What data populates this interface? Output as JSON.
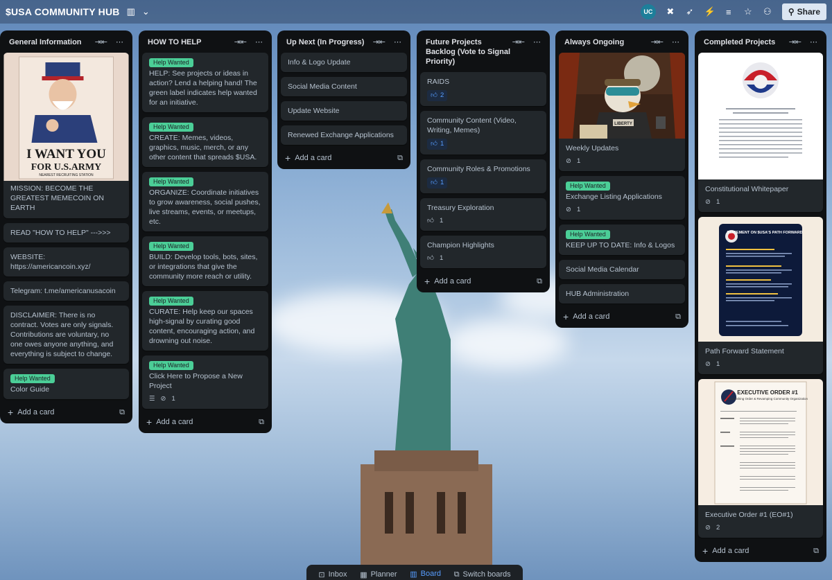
{
  "board": {
    "title": "$USA COMMUNITY HUB",
    "avatar_initials": "UC",
    "share_label": "Share"
  },
  "icons": {
    "view": "board-view-icon",
    "chevron": "chevron-down-icon",
    "collapse": "collapse-icon",
    "more": "more-icon"
  },
  "lists": [
    {
      "title": "General Information",
      "cards": [
        {
          "type": "cover",
          "cover": "uncle-sam-poster",
          "text": "MISSION: BECOME THE GREATEST MEMECOIN ON EARTH"
        },
        {
          "text": "READ \"HOW TO HELP\" --->>>"
        },
        {
          "text": "WEBSITE: https://americancoin.xyz/"
        },
        {
          "text": "Telegram: t.me/americanusacoin"
        },
        {
          "text": "DISCLAIMER: There is no contract. Votes are only signals. Contributions are voluntary, no one owes anyone anything, and everything is subject to change."
        },
        {
          "label": "Help Wanted",
          "text": "Color Guide"
        }
      ],
      "add_label": "Add a card"
    },
    {
      "title": "HOW TO HELP",
      "cards": [
        {
          "label": "Help Wanted",
          "text": "HELP: See projects or ideas in action? Lend a helping hand! The green label indicates help wanted for an initiative."
        },
        {
          "label": "Help Wanted",
          "text": "CREATE: Memes, videos, graphics, music, merch, or any other content that spreads $USA."
        },
        {
          "label": "Help Wanted",
          "text": "ORGANIZE: Coordinate initiatives to grow awareness, social pushes, live streams, events, or meetups, etc."
        },
        {
          "label": "Help Wanted",
          "text": "BUILD: Develop tools, bots, sites, or integrations that give the community more reach or utility."
        },
        {
          "label": "Help Wanted",
          "text": "CURATE: Help keep our spaces high-signal by curating good content, encouraging action, and drowning out noise."
        },
        {
          "label": "Help Wanted",
          "text": "Click Here to Propose a New Project",
          "desc": true,
          "attachments": "1"
        }
      ],
      "add_label": "Add a card"
    },
    {
      "title": "Up Next (In Progress)",
      "cards": [
        {
          "text": "Info & Logo Update"
        },
        {
          "text": "Social Media Content"
        },
        {
          "text": "Update Website"
        },
        {
          "text": "Renewed Exchange Applications"
        }
      ],
      "add_label": "Add a card"
    },
    {
      "title": "Future Projects Backlog (Vote to Signal Priority)",
      "cards": [
        {
          "text": "RAIDS",
          "votes": "2",
          "voted": true
        },
        {
          "text": "Community Content (Video, Writing, Memes)",
          "votes": "1",
          "voted": true
        },
        {
          "text": "Community Roles & Promotions",
          "votes": "1",
          "voted": true
        },
        {
          "text": "Treasury Exploration",
          "votes": "1",
          "voted": false
        },
        {
          "text": "Champion Highlights",
          "votes": "1",
          "voted": false
        }
      ],
      "add_label": "Add a card"
    },
    {
      "title": "Always Ongoing",
      "cards": [
        {
          "type": "cover",
          "cover": "eagle-pilot-illustration",
          "text": "Weekly Updates",
          "attachments": "1"
        },
        {
          "label": "Help Wanted",
          "text": "Exchange Listing Applications",
          "attachments": "1"
        },
        {
          "label": "Help Wanted",
          "text": "KEEP UP TO DATE: Info & Logos"
        },
        {
          "text": "Social Media Calendar"
        },
        {
          "text": "HUB Administration"
        }
      ],
      "add_label": "Add a card"
    },
    {
      "title": "Completed Projects",
      "cards": [
        {
          "type": "cover",
          "cover": "whitepaper-doc",
          "text": "Constitutional Whitepaper",
          "attachments": "1"
        },
        {
          "type": "cover",
          "cover": "path-forward-statement",
          "text": "Path Forward Statement",
          "attachments": "1"
        },
        {
          "type": "cover",
          "cover": "executive-order-doc",
          "text": "Executive Order #1 (EO#1)",
          "attachments": "2"
        }
      ],
      "add_label": "Add a card"
    }
  ],
  "covers": {
    "poster_line1": "I WANT YOU",
    "poster_line2": "FOR U.S.ARMY",
    "poster_line3": "NEAREST RECRUITING STATION",
    "eagle_tag": "LIBERTY",
    "statement_title": "STATEMENT ON $USA'S PATH FORWARD",
    "eo_title": "EXECUTIVE ORDER #1",
    "eo_subtitle": "Establishing Order & Revamping Community Organization"
  },
  "nav": {
    "inbox": "Inbox",
    "planner": "Planner",
    "board": "Board",
    "switch": "Switch boards"
  },
  "colors": {
    "label_green": "#4bce97",
    "list_bg": "#0f1113",
    "card_bg": "#22272b",
    "vote_blue": "#579dff"
  }
}
